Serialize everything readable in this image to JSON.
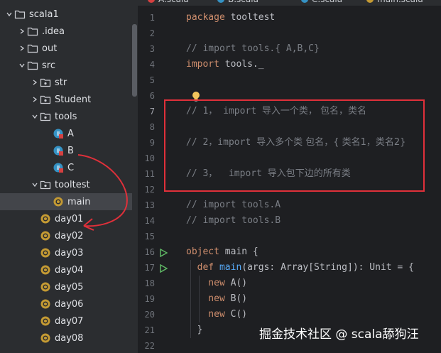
{
  "tabs": [
    {
      "label": "A.scala",
      "active": false
    },
    {
      "label": "B.scala",
      "active": false
    },
    {
      "label": "C.scala",
      "active": false
    },
    {
      "label": "main.scala",
      "active": true
    }
  ],
  "project_tree": [
    {
      "label": "scala1",
      "icon": "folder-icon",
      "expanded": true,
      "depth": 0
    },
    {
      "label": ".idea",
      "icon": "folder-icon",
      "expanded": false,
      "depth": 1
    },
    {
      "label": "out",
      "icon": "folder-icon",
      "expanded": false,
      "depth": 1
    },
    {
      "label": "src",
      "icon": "folder-icon",
      "expanded": true,
      "depth": 1
    },
    {
      "label": "str",
      "icon": "package-icon",
      "expanded": false,
      "depth": 2
    },
    {
      "label": "Student",
      "icon": "package-icon",
      "expanded": false,
      "depth": 2
    },
    {
      "label": "tools",
      "icon": "package-icon",
      "expanded": true,
      "depth": 2
    },
    {
      "label": "A",
      "icon": "scala-class-icon",
      "depth": 3
    },
    {
      "label": "B",
      "icon": "scala-class-icon",
      "depth": 3
    },
    {
      "label": "C",
      "icon": "scala-class-icon",
      "depth": 3
    },
    {
      "label": "tooltest",
      "icon": "package-icon",
      "expanded": true,
      "depth": 2
    },
    {
      "label": "main",
      "icon": "scala-object-icon",
      "depth": 3,
      "selected": true
    },
    {
      "label": "day01",
      "icon": "scala-object-icon",
      "depth": 2
    },
    {
      "label": "day02",
      "icon": "scala-object-icon",
      "depth": 2
    },
    {
      "label": "day03",
      "icon": "scala-object-icon",
      "depth": 2
    },
    {
      "label": "day04",
      "icon": "scala-object-icon",
      "depth": 2
    },
    {
      "label": "day05",
      "icon": "scala-object-icon",
      "depth": 2
    },
    {
      "label": "day06",
      "icon": "scala-object-icon",
      "depth": 2
    },
    {
      "label": "day07",
      "icon": "scala-object-icon",
      "depth": 2
    },
    {
      "label": "day08",
      "icon": "scala-object-icon",
      "depth": 2
    }
  ],
  "editor": {
    "current_line": 7,
    "line_numbers": [
      "1",
      "2",
      "3",
      "4",
      "5",
      "6",
      "7",
      "8",
      "9",
      "10",
      "11",
      "12",
      "13",
      "14",
      "15",
      "16",
      "17",
      "18",
      "19",
      "20",
      "21",
      "22"
    ],
    "run_gutter_lines": [
      16,
      17
    ],
    "lines": [
      {
        "segments": [
          {
            "t": "package ",
            "c": "kw"
          },
          {
            "t": "tooltest",
            "c": "id"
          }
        ]
      },
      {
        "segments": []
      },
      {
        "segments": [
          {
            "t": "// import tools.{ A,B,C}",
            "c": "cm"
          }
        ]
      },
      {
        "segments": [
          {
            "t": "import ",
            "c": "kw"
          },
          {
            "t": "tools._",
            "c": "id"
          }
        ]
      },
      {
        "segments": []
      },
      {
        "segments": []
      },
      {
        "segments": [
          {
            "t": "// 1， import ",
            "c": "cm"
          },
          {
            "t": "导入一个类， 包名，类名",
            "c": "cmcjk"
          }
        ]
      },
      {
        "segments": []
      },
      {
        "segments": [
          {
            "t": "// 2，import ",
            "c": "cm"
          },
          {
            "t": "导入多个类 包名，{ 类名1，类名2}",
            "c": "cmcjk"
          }
        ]
      },
      {
        "segments": []
      },
      {
        "segments": [
          {
            "t": "// 3，  import ",
            "c": "cm"
          },
          {
            "t": "导入包下边的所有类",
            "c": "cmcjk"
          }
        ]
      },
      {
        "segments": []
      },
      {
        "segments": [
          {
            "t": "// import tools.A",
            "c": "cm"
          }
        ]
      },
      {
        "segments": [
          {
            "t": "// import tools.B",
            "c": "cm"
          }
        ]
      },
      {
        "segments": []
      },
      {
        "segments": [
          {
            "t": "object ",
            "c": "kw"
          },
          {
            "t": "main {",
            "c": "id"
          }
        ]
      },
      {
        "segments": [
          {
            "t": "  def ",
            "c": "kw"
          },
          {
            "t": "main",
            "c": "fn"
          },
          {
            "t": "(args: Array[String]): Unit = {",
            "c": "id"
          }
        ]
      },
      {
        "segments": [
          {
            "t": "    new ",
            "c": "kw"
          },
          {
            "t": "A()",
            "c": "id"
          }
        ]
      },
      {
        "segments": [
          {
            "t": "    new ",
            "c": "kw"
          },
          {
            "t": "B()",
            "c": "id"
          }
        ]
      },
      {
        "segments": [
          {
            "t": "    new ",
            "c": "kw"
          },
          {
            "t": "C()",
            "c": "id"
          }
        ]
      },
      {
        "segments": [
          {
            "t": "  }",
            "c": "id"
          }
        ]
      },
      {
        "segments": []
      }
    ]
  },
  "watermark": "掘金技术社区 @ scala舔狗汪",
  "colors": {
    "selection": "#43454a",
    "annotation_red": "#e0303a",
    "keyword": "#cf8e6d",
    "comment": "#7a7e85",
    "function": "#56a8f5"
  }
}
